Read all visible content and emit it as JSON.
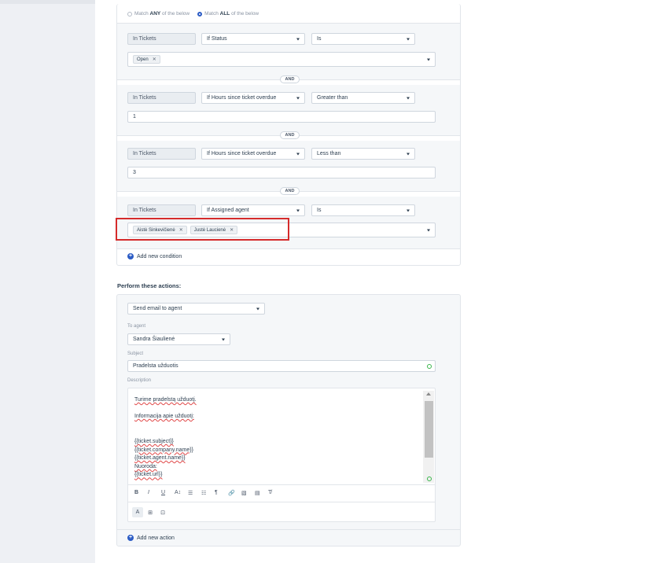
{
  "match": {
    "any_prefix": "Match ",
    "any_strong": "ANY",
    "any_suffix": " of the below",
    "all_prefix": "Match ",
    "all_strong": "ALL",
    "all_suffix": " of the below",
    "selected": "all"
  },
  "conditions": [
    {
      "scope": "In Tickets",
      "field": "If Status",
      "operator": "Is",
      "values": [
        "Open"
      ],
      "value_text": ""
    },
    {
      "scope": "In Tickets",
      "field": "If Hours since ticket overdue",
      "operator": "Greater than",
      "values": [],
      "value_text": "1"
    },
    {
      "scope": "In Tickets",
      "field": "If Hours since ticket overdue",
      "operator": "Less than",
      "values": [],
      "value_text": "3"
    },
    {
      "scope": "In Tickets",
      "field": "If Assigned agent",
      "operator": "Is",
      "values": [
        "Aistė Sinkevičienė",
        "Justė Laucienė"
      ],
      "value_text": ""
    }
  ],
  "and_label": "AND",
  "add_condition_label": "Add new condition",
  "actions_title": "Perform these actions:",
  "action": {
    "type": "Send email to agent",
    "to_agent_label": "To agent",
    "to_agent": "Sandra Šiaulienė",
    "subject_label": "Subject",
    "subject": "Pradelsta užduotis",
    "description_label": "Description",
    "description_lines": [
      "Turime pradelstą užduotį.",
      "",
      "Informacija apie užduotį:",
      "",
      "",
      "{{ticket.subject}}",
      "{{ticket.company.name}}",
      "{{ticket.agent.name}}",
      "Nuoroda:",
      "{{ticket.url}}"
    ]
  },
  "toolbar": [
    "B",
    "I",
    "U",
    "A↕",
    "☰",
    "☷",
    "¶",
    "🔗",
    "▧",
    "▤",
    "T̸"
  ],
  "toolbar2": [
    "A",
    "⊞",
    "⊡"
  ],
  "add_action_label": "Add new action",
  "colors": {
    "accent": "#2c5cc5",
    "highlight": "#d52b2b",
    "success": "#39b54a"
  },
  "icons": {
    "dropdown": "chevron-down-icon",
    "remove": "close-icon",
    "add": "plus-circle-icon",
    "placeholder": "placeholder-insert-icon"
  }
}
